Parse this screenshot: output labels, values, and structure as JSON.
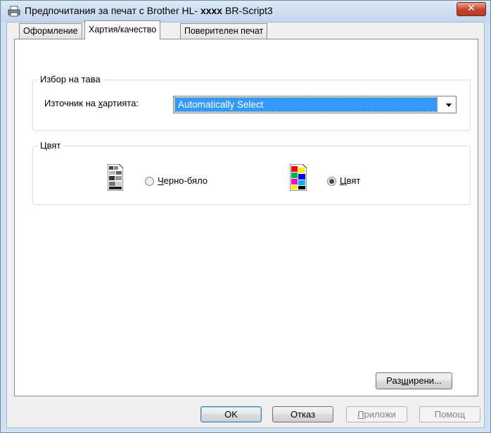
{
  "window": {
    "title_prefix": "Предпочитания за печат с Brother HL- ",
    "title_model": "xxxx",
    "title_suffix": " BR-Script3",
    "close_glyph": "✕"
  },
  "tabs": [
    {
      "label": "Оформление",
      "active": false
    },
    {
      "label": "Хартия/качество",
      "active": true
    },
    {
      "label": "Поверителен печат",
      "active": false
    }
  ],
  "tray_group": {
    "title": "Избор на тава",
    "source_label_pre": "Източник на ",
    "source_label_accel": "х",
    "source_label_post": "артията:",
    "source_value": "Automatically Select"
  },
  "color_group": {
    "title": "Цвят",
    "bw_accel": "Ч",
    "bw_label_rest": "ерно-бяло",
    "color_accel": "Ц",
    "color_label_rest": "вят",
    "selected": "color"
  },
  "buttons": {
    "advanced_pre": "Раз",
    "advanced_accel": "ш",
    "advanced_post": "ирени...",
    "ok": "OK",
    "cancel": "Отказ",
    "apply_accel": "П",
    "apply_rest": "риложи",
    "help": "Помощ"
  },
  "colors": {
    "selection": "#3399ff",
    "title_bar": "#c3d6ec",
    "close_button": "#c4412a"
  }
}
